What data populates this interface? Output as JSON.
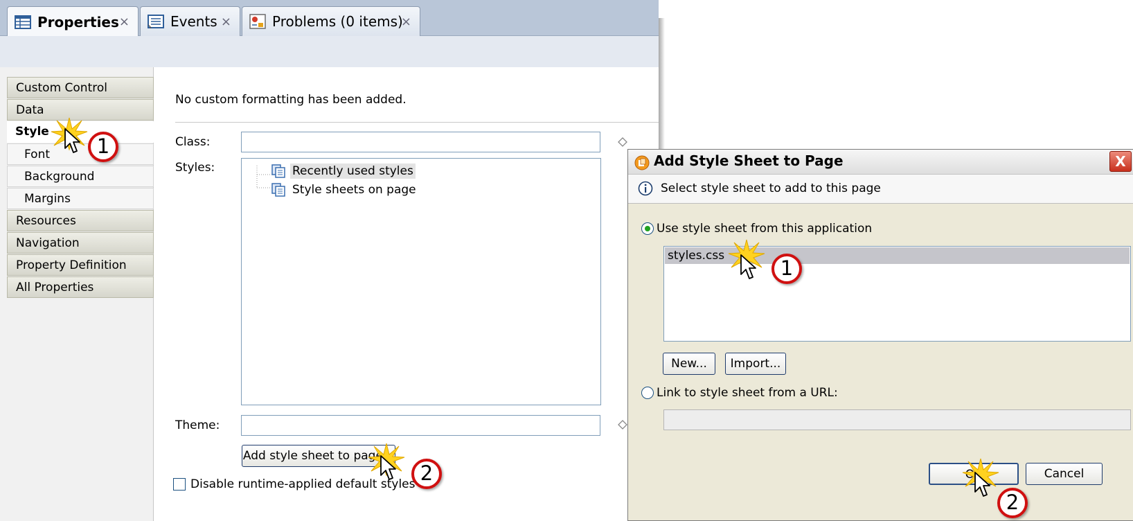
{
  "tabs": [
    {
      "label": "Properties",
      "icon": "properties-icon",
      "close": "×"
    },
    {
      "label": "Events",
      "icon": "events-icon",
      "close": "×"
    },
    {
      "label": "Problems (0 items)",
      "icon": "problems-icon",
      "close": "×"
    }
  ],
  "nav": {
    "items": [
      {
        "label": "Custom Control",
        "kind": "category"
      },
      {
        "label": "Data",
        "kind": "category"
      },
      {
        "label": "Style",
        "kind": "selected"
      },
      {
        "label": "Font",
        "kind": "sub"
      },
      {
        "label": "Background",
        "kind": "sub"
      },
      {
        "label": "Margins",
        "kind": "sub"
      },
      {
        "label": "Resources",
        "kind": "category"
      },
      {
        "label": "Navigation",
        "kind": "category"
      },
      {
        "label": "Property Definition",
        "kind": "category"
      },
      {
        "label": "All Properties",
        "kind": "category"
      }
    ]
  },
  "style_panel": {
    "message": "No custom formatting has been added.",
    "class_label": "Class:",
    "class_value": "",
    "styles_label": "Styles:",
    "tree": [
      "Recently used styles",
      "Style sheets on page"
    ],
    "theme_label": "Theme:",
    "theme_value": "",
    "add_button": "Add style sheet to page...",
    "disable_checkbox": "Disable runtime-applied default styles",
    "disable_checked": false
  },
  "dialog": {
    "title": "Add Style Sheet to Page",
    "close": "X",
    "info": "Select style sheet to add to this page",
    "option_app": "Use style sheet from this application",
    "option_app_selected": true,
    "stylesheets": [
      "styles.css"
    ],
    "selected_stylesheet": "styles.css",
    "new_button": "New...",
    "import_button": "Import...",
    "option_url": "Link to style sheet from a URL:",
    "url_value": "",
    "ok_button": "OK",
    "cancel_button": "Cancel"
  },
  "callouts": {
    "step1": "1",
    "step2": "2"
  },
  "colors": {
    "tab_bar": "#b9c6d8",
    "dialog_bg": "#ece9d8",
    "selection": "#c5c5cb",
    "callout_ring": "#d01010",
    "burst": "#ffd21f"
  }
}
